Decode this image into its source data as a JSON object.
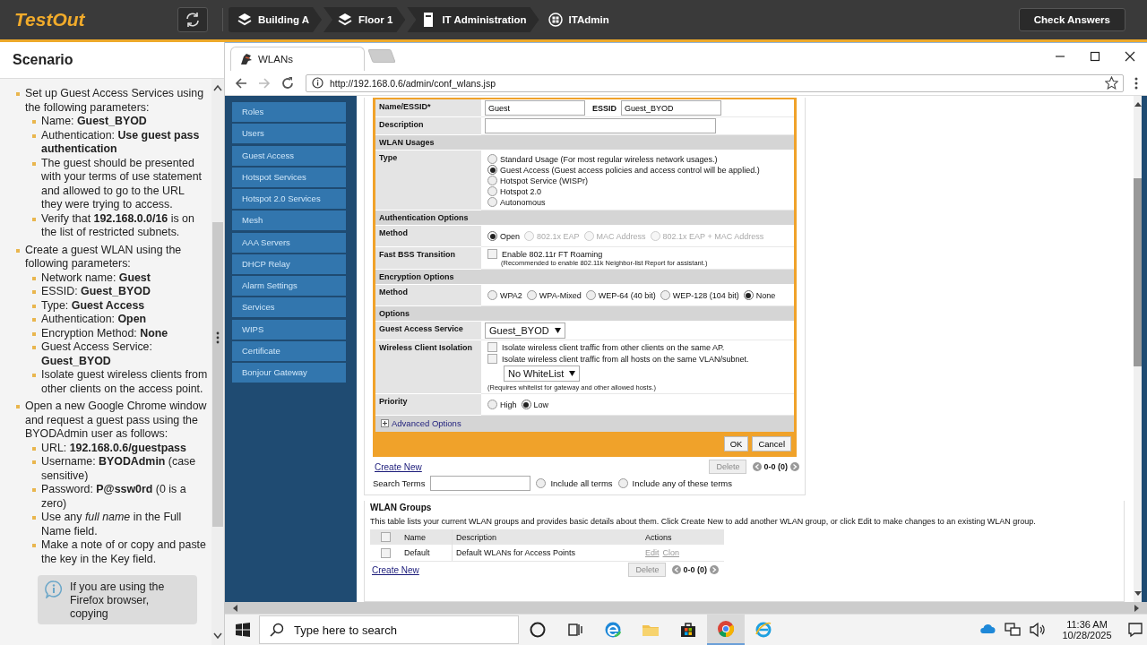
{
  "topbar": {
    "logo": "TestOut",
    "breadcrumbs": [
      {
        "label": "Building A",
        "kind": "layers"
      },
      {
        "label": "Floor 1",
        "kind": "layers"
      },
      {
        "label": "IT Administration",
        "kind": "server"
      },
      {
        "label": "ITAdmin",
        "kind": "computer"
      }
    ],
    "action": "Check Answers"
  },
  "scenario": {
    "title": "Scenario",
    "tasks": [
      {
        "text": "Set up Guest Access Services using the following parameters:",
        "children": [
          {
            "text": "Name: **Guest_BYOD**"
          },
          {
            "text": "Authentication: **Use guest pass authentication**"
          },
          {
            "text": "The guest should be presented with your terms of use statement and allowed to go to the URL they were trying to access."
          },
          {
            "text": "Verify that **192.168.0.0/16** is on the list of restricted subnets."
          }
        ]
      },
      {
        "text": "Create a guest WLAN using the following parameters:",
        "children": [
          {
            "text": "Network name: **Guest**"
          },
          {
            "text": "ESSID: **Guest_BYOD**"
          },
          {
            "text": "Type: **Guest Access**"
          },
          {
            "text": "Authentication: **Open**"
          },
          {
            "text": "Encryption Method: **None**"
          },
          {
            "text": "Guest Access Service: **Guest_BYOD**"
          },
          {
            "text": "Isolate guest wireless clients from other clients on the access point."
          }
        ]
      },
      {
        "text": "Open a new Google Chrome window and request a guest pass using the BYODAdmin user as follows:",
        "children": [
          {
            "text": "URL: **192.168.0.6/guestpass**"
          },
          {
            "text": "Username: **BYODAdmin** (case sensitive)"
          },
          {
            "text": "Password: **P@ssw0rd** (0 is a zero)"
          },
          {
            "text": "Use any *full name* in the Full Name field."
          },
          {
            "text": "Make a note of or copy and paste the key in the Key field."
          }
        ]
      }
    ],
    "note": "If you are using the Firefox browser, copying"
  },
  "browser": {
    "tab": "WLANs",
    "url": "http://192.168.0.6/admin/conf_wlans.jsp"
  },
  "nav": {
    "items": [
      "Roles",
      "Users",
      "Guest Access",
      "Hotspot Services",
      "Hotspot 2.0 Services",
      "Mesh",
      "AAA Servers",
      "DHCP Relay",
      "Alarm Settings",
      "Services",
      "WIPS",
      "Certificate",
      "Bonjour Gateway"
    ]
  },
  "form": {
    "rows": [
      {
        "kind": "name",
        "label": "Name/ESSID*",
        "value": "Guest",
        "label_2": "ESSID",
        "value_2": "Guest_BYOD"
      },
      {
        "kind": "input",
        "label": "Description"
      },
      {
        "kind": "section",
        "label": "WLAN Usages"
      },
      {
        "kind": "radio-column",
        "label": "Type",
        "options": [
          {
            "label": "Standard Usage (For most regular wireless network usages.)",
            "selected": false,
            "disabled": false
          },
          {
            "label": "Guest Access (Guest access policies and access control will be applied.)",
            "selected": true,
            "disabled": false
          },
          {
            "label": "Hotspot Service (WISPr)",
            "selected": false,
            "disabled": false
          },
          {
            "label": "Hotspot 2.0",
            "selected": false,
            "disabled": false
          },
          {
            "label": "Autonomous",
            "selected": false,
            "disabled": false
          }
        ]
      },
      {
        "kind": "section",
        "label": "Authentication Options"
      },
      {
        "kind": "radios",
        "label": "Method",
        "options": [
          {
            "label": "Open",
            "selected": true,
            "disabled": false
          },
          {
            "label": "802.1x EAP",
            "selected": false,
            "disabled": true
          },
          {
            "label": "MAC Address",
            "selected": false,
            "disabled": true
          },
          {
            "label": "802.1x EAP + MAC Address",
            "selected": false,
            "disabled": true
          }
        ]
      },
      {
        "kind": "checkbox",
        "label": "Fast BSS Transition",
        "options": [
          {
            "label": "Enable 802.11r FT Roaming",
            "checked": false,
            "note": "(Recommended to enable 802.11k Neighbor-list Report for assistant.)"
          }
        ]
      },
      {
        "kind": "section",
        "label": "Encryption Options"
      },
      {
        "kind": "radios",
        "label": "Method",
        "options": [
          {
            "label": "WPA2",
            "selected": false,
            "disabled": false
          },
          {
            "label": "WPA-Mixed",
            "selected": false,
            "disabled": false
          },
          {
            "label": "WEP-64 (40 bit)",
            "selected": false,
            "disabled": false
          },
          {
            "label": "WEP-128 (104 bit)",
            "selected": false,
            "disabled": false
          },
          {
            "label": "None",
            "selected": true,
            "disabled": false
          }
        ]
      },
      {
        "kind": "section",
        "label": "Options"
      },
      {
        "kind": "select",
        "label": "Guest Access Service",
        "value": "Guest_BYOD"
      },
      {
        "kind": "checkbox",
        "label": "Wireless Client Isolation",
        "options": [
          {
            "label": "Isolate wireless client traffic from other clients on the same AP.",
            "checked": false
          },
          {
            "label": "Isolate wireless client traffic from all hosts on the same VLAN/subnet.",
            "checked": false,
            "select": "No WhiteList"
          }
        ],
        "note": "(Requires whitelist for gateway and other allowed hosts.)"
      },
      {
        "kind": "radios",
        "label": "Priority",
        "options": [
          {
            "label": "High",
            "selected": false,
            "disabled": false
          },
          {
            "label": "Low",
            "selected": true,
            "disabled": false
          }
        ]
      },
      {
        "kind": "expander",
        "label": "Advanced Options",
        "expanded": false
      }
    ],
    "buttons": [
      "OK",
      "Cancel"
    ]
  },
  "list_tools": {
    "create": "Create New",
    "delete": "Delete",
    "pager": "0-0 (0)",
    "search_label": "Search Terms",
    "search_options": [
      {
        "label": "Include all terms",
        "selected": false
      },
      {
        "label": "Include any of these terms",
        "selected": false
      }
    ]
  },
  "wlan_groups": {
    "title": "WLAN Groups",
    "description": "This table lists your current WLAN groups and provides basic details about them. Click Create New to add another WLAN group, or click Edit to make changes to an existing WLAN group.",
    "header_checked": false,
    "columns": [
      "Name",
      "Description",
      "Actions"
    ],
    "rows": [
      {
        "checked": false,
        "name": "Default",
        "description": "Default WLANs for Access Points",
        "actions": [
          "Edit",
          "Clon"
        ]
      }
    ],
    "create": "Create New",
    "delete": "Delete",
    "pager": "0-0 (0)"
  },
  "taskbar": {
    "search_placeholder": "Type here to search",
    "apps": [
      {
        "kind": "cortana",
        "selected": false
      },
      {
        "kind": "taskview",
        "selected": false
      },
      {
        "kind": "edge",
        "selected": false
      },
      {
        "kind": "explorer",
        "selected": false
      },
      {
        "kind": "store",
        "selected": false
      },
      {
        "kind": "chrome",
        "selected": true
      },
      {
        "kind": "ie",
        "selected": false
      }
    ],
    "tray": [
      {
        "kind": "cloud"
      },
      {
        "kind": "network"
      },
      {
        "kind": "volume"
      }
    ],
    "time": "11:36 AM",
    "date": "10/28/2025"
  }
}
